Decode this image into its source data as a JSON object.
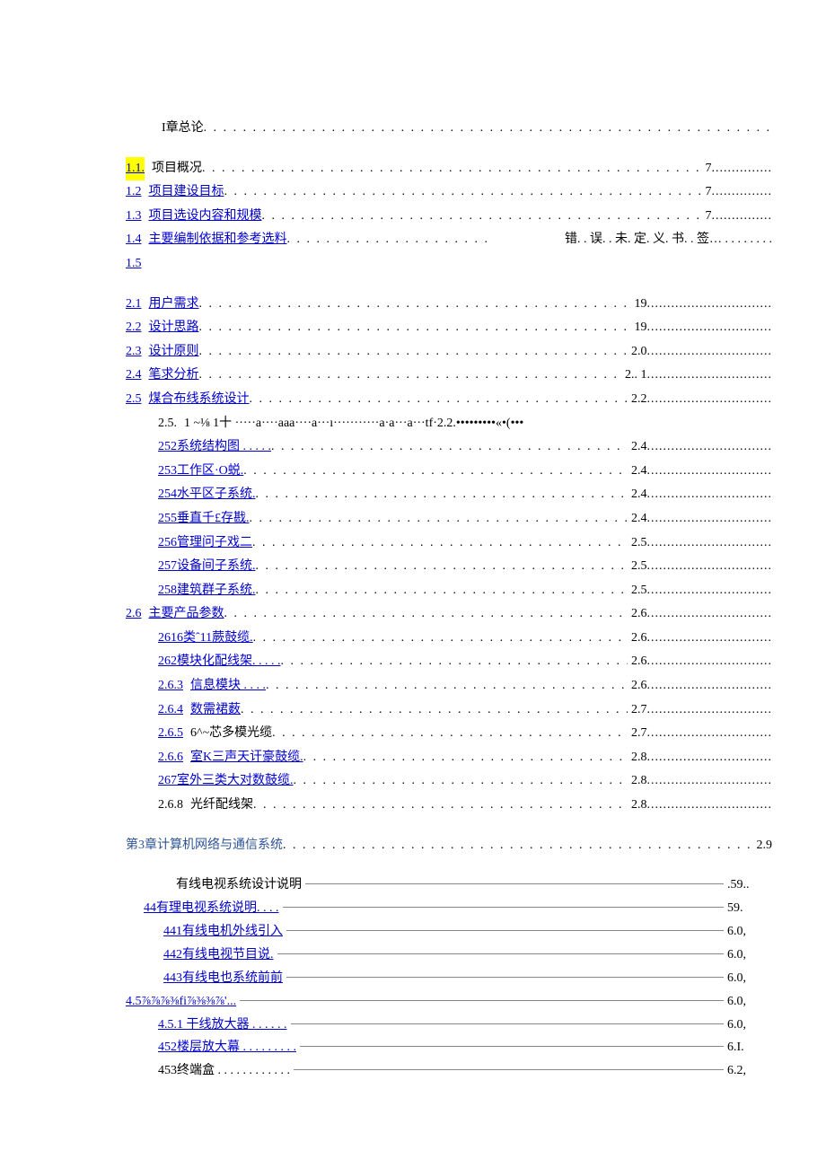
{
  "toc": [
    {
      "indent": 40,
      "num": "",
      "numLink": false,
      "label": "I章总论",
      "labelLink": false,
      "labelHl": false,
      "leader": ". . . . . . . . . . . . . . . . . . . . . . . . . . . . . . . . . . . . . . . . . . . . . . . . . . . . . . . . . . . . . . . .",
      "page": "",
      "trail": ""
    },
    {
      "gap": true
    },
    {
      "indent": 0,
      "num": "1.1.",
      "numLink": true,
      "numHl": true,
      "label": "项目概况",
      "labelLink": false,
      "labelHl": false,
      "leader": ". . . . . . . . . . . . . . . . . . . . . . . . . . . . . . . . . . . . . . . . . . . . . . . . . . . . . . . . . . . . . . . . . . . . . . .",
      "page": "7",
      "trail": " ..............."
    },
    {
      "indent": 0,
      "num": "1.2",
      "numLink": true,
      "label": "项目建设目标",
      "labelLink": true,
      "leader": ". . . . . . . . . . . . . . . . . . . . . . . . . . . . . . . . . . . . . . . . . . . . . . . . . . . . . . . . . . . .",
      "page": "7",
      "trail": " ..............."
    },
    {
      "indent": 0,
      "num": "1.3",
      "numLink": true,
      "label": "项目选设内容和规模",
      "labelLink": true,
      "leader": ". . . . . . . . . . . . . . . . . . . . . . . . . . . . . . . . . . . . . . . . . . . . . . . . . . . .",
      "page": "7",
      "trail": " ..............."
    },
    {
      "indent": 0,
      "num": "1.4",
      "numLink": true,
      "label": "主要编制依据和参考选料",
      "labelLink": true,
      "leader": " . . . . . . . . . . . . . . . . . . . . .",
      "page": "错. . 误. . 未. 定. 义. 书. . 签… . . . . . . . .",
      "trail": ""
    },
    {
      "indent": 0,
      "num": "1.5",
      "numLink": true,
      "label": "",
      "labelLink": false,
      "leader": "",
      "page": "",
      "trail": ""
    },
    {
      "gap": true
    },
    {
      "indent": 0,
      "num": "2.1",
      "numLink": true,
      "label": "用户需求",
      "labelLink": true,
      "leader": ". . . . . . . . . . . . . . . . . . . . . . . . . . . . . . . . . . . . . . . . . . . . . . . . . . . . . . . . . . . . . . . . . . . . .",
      "page": "19",
      "trail": " ..............................."
    },
    {
      "indent": 0,
      "num": "2.2",
      "numLink": true,
      "label": "设计思路",
      "labelLink": true,
      "leader": " . . . . . . . . . . . . . . . . . . . . . . . . . . . . . . . . . . . . . . . . . . . . . . . . . . . . . . . . . . . . . . . . . . . .",
      "page": "19",
      "trail": " ..............................."
    },
    {
      "indent": 0,
      "num": "2.3",
      "numLink": true,
      "label": "设计原则",
      "labelLink": true,
      "leader": ". . . . . . . . . . . . . . . . . . . . . . . . . . . . . . . . . . . . . . . . . . . . . . . . . . . . . . . . . . . . . . . . . .",
      "page": "2.0",
      "trail": " ..............................."
    },
    {
      "indent": 0,
      "num": "2.4",
      "numLink": true,
      "label": "笔求分析",
      "labelLink": true,
      "leader": " . . . . . . . . . . . . . . . . . . . . . . . . . . . . . . . . . . . . . . . . . . . . . . . . . . . . . . . . . . . . . . .",
      "page": "2..  1",
      "trail": " ..............................."
    },
    {
      "indent": 0,
      "num": "2.5",
      "numLink": true,
      "label": "煤合布线系统设计",
      "labelLink": true,
      "leader": ". . . . . . . . . . . . . . . . . . . . . . . . . . . . . . . . . . . . . . . . . . . . . . . . . . . . . . .",
      "page": "2.2",
      "trail": " ..............................."
    },
    {
      "indent": 36,
      "num": "2.5.",
      "numLink": false,
      "label": "1     ~⅛     1十 ·····a····aaa····a···ı···········a·a···a···tf·2.2.•••••••••«•(•••",
      "labelLink": false,
      "leader": "",
      "page": "",
      "trail": ""
    },
    {
      "indent": 36,
      "num": "",
      "numLink": false,
      "label": "252系统结构图 . . . . .",
      "labelLink": true,
      "leader": "  . . . . . . . . . . . . . . . . . . . . . . . . . . . . . . . . . . . . . . . . . . . . . . . . . . . . . . . .",
      "page": "2.4",
      "trail": " ..............................."
    },
    {
      "indent": 36,
      "num": "",
      "numLink": false,
      "label": "253工作区·O蜕.",
      "labelLink": true,
      "leader": " . . . . . . . . . . . . . . . . . . . . . . . . . . . . . . . . . . . . . . . . . . . . . . . . . . . . . . . . . . . . .",
      "page": "2.4",
      "trail": " ..............................."
    },
    {
      "indent": 36,
      "num": "",
      "numLink": false,
      "label": "254水平区子系统.",
      "labelLink": true,
      "leader": " . . . . . . . . . . . . . . . . . . . . . . . . . . . . . . . . . . . . . . . . . . . . . . . . . . . . . . . . . .",
      "page": "2.4",
      "trail": " ..............................."
    },
    {
      "indent": 36,
      "num": "",
      "numLink": false,
      "label": "255垂直千£存戡.",
      "labelLink": true,
      "leader": " . . . . . . . . . . . . . . . . . . . . . . . . . . . . . . . . . . . . . . . . . . . . . . . . . . . . . . . . .",
      "page": "2.4",
      "trail": " ..............................."
    },
    {
      "indent": 36,
      "num": "",
      "numLink": false,
      "label": "256管理问子戏二",
      "labelLink": true,
      "leader": ". . . . . . . . . . . . . . . . . . . . . . . . . . . . . . . . . . . . . . . . . . . . . . . . . . . . . . . . . . .",
      "page": "2.5",
      "trail": " ..............................."
    },
    {
      "indent": 36,
      "num": "",
      "numLink": false,
      "label": "257设备间子系统.",
      "labelLink": true,
      "leader": " . . . . . . . . . . . . . . . . . . . . . . . . . . . . . . . . . . . . . . . . . . . . . . . . . . . . . . . . . .",
      "page": "2.5",
      "trail": " ..............................."
    },
    {
      "indent": 36,
      "num": "",
      "numLink": false,
      "label": "258建筑群子系统.",
      "labelLink": true,
      "leader": " . . . . . . . . . . . . . . . . . . . . . . . . . . . . . . . . . . . . . . . . . . . . . . . . . . . . . . . . . .",
      "page": "2.5",
      "trail": " ..............................."
    },
    {
      "indent": 0,
      "num": "2.6",
      "numLink": true,
      "label": "主要产品参数",
      "labelLink": true,
      "leader": ". . . . . . . . . . . . . . . . . . . . . . . . . . . . . . . . . . . . . . . . . . . . . . . . . . . . . . . . . . . .",
      "page": "2.6",
      "trail": " ..............................."
    },
    {
      "indent": 36,
      "num": "",
      "numLink": false,
      "label": "2616类ˆ11蕨鼓缆.",
      "labelLink": true,
      "leader": " . . . . . . . . . . . . . . . . . . . . . . . . . . . . . . . . . . . . . . . . . . . . . . . . . . . . . . . . .",
      "page": "2.6",
      "trail": " ..............................."
    },
    {
      "indent": 36,
      "num": "",
      "numLink": false,
      "label": "262模块化配线架. . . . .",
      "labelLink": true,
      "leader": ". . . . . . . . . . . . . . . . . . . . . . . . . . . . . . . . . . . . . . . . . . . . . . . . . . . . .",
      "page": "2.6",
      "trail": " ..............................."
    },
    {
      "indent": 36,
      "num": "2.6.3",
      "numLink": true,
      "label": "信息模块 . . . .",
      "labelLink": true,
      "leader": " . . . . . . . . . . . . . . . . . . . . . . . . . . . . . . . . . . . . . . . . . . . . . . . . . . . . . . .",
      "page": "2.6",
      "trail": " ..............................."
    },
    {
      "indent": 36,
      "num": "2.6.4",
      "numLink": true,
      "label": "数需裙薮",
      "labelLink": true,
      "leader": " . . . . . . . . . . . . . . . . . . . . . . . . . . . . . . . . . . . . . . . . . . . . . . . . . . . . . . . . . . .",
      "page": "2.7",
      "trail": " ..............................."
    },
    {
      "indent": 36,
      "num": "2.6.5",
      "numLink": true,
      "label": "6^~芯多模光缆",
      "labelLink": false,
      "leader": " . . . . . . . . . . . . . . . . . . . . . . . . . . . . . . . . . . . . . . . . . . . . . . . . . . . . .",
      "page": "2.7",
      "trail": " ..............................."
    },
    {
      "indent": 36,
      "num": "2.6.6",
      "numLink": true,
      "label": "室K三声天讦豪鼓缆.",
      "labelLink": true,
      "leader": " . . . . . . . . . . . . . . . . . . . . . . . . . . . . . . . . . . . . . . . . . . . . . . . .",
      "page": "2.8",
      "trail": " ..............................."
    },
    {
      "indent": 36,
      "num": "",
      "numLink": false,
      "label": "267室外三类大对数鼓缆.",
      "labelLink": true,
      "leader": " . . . . . . . . . . . . . . . . . . . . . . . . . . . . . . . . . . . . . . . . . . . . . . . . . .",
      "page": "2.8",
      "trail": " ..............................."
    },
    {
      "indent": 36,
      "num": "2.6.8",
      "numLink": false,
      "label": "光纤配线架",
      "labelLink": false,
      "leader": " . . . . . . . . . . . . . . . . . . . . . . . . . . . . . . . . . . . . . . . . . . . . . . . . . . . . . . . .",
      "page": "2.8",
      "trail": " ..............................."
    },
    {
      "gap": true
    },
    {
      "indent": 0,
      "num": "",
      "numLink": false,
      "label": "第3章计算机网络与通信系统",
      "labelLink": false,
      "labelClass": "sec3",
      "leader": " . . . . . . . . . . . . . . . . . . . . . . . . . . . . . . . . . . . . . . . . . . . . . . . .",
      "page": "2.9",
      "trail": ""
    },
    {
      "gap": true
    }
  ],
  "table": [
    {
      "indent": 56,
      "label": "有线电视系统设计说明",
      "labelLink": false,
      "page": ".59.."
    },
    {
      "indent": 20,
      "label": "44有理电视系统说明. . . .",
      "labelLink": true,
      "page": "59."
    },
    {
      "indent": 42,
      "label": "441有线电机外线引入",
      "labelLink": true,
      "page": "6.0,"
    },
    {
      "indent": 42,
      "label": "442有线电视节目说.",
      "labelLink": true,
      "page": "6.0,"
    },
    {
      "indent": 42,
      "label": "443有线电也系统前前",
      "labelLink": true,
      "page": "6.0,"
    },
    {
      "indent": 0,
      "label": "4.5⅞⅞⅞⅜fi⅞⅜⅜⅞'...",
      "labelLink": true,
      "page": "6.0,"
    },
    {
      "indent": 36,
      "label": "4.5.1   干线放大器 . . . . . .",
      "labelLink": true,
      "page": "6.0,"
    },
    {
      "indent": 36,
      "label": "452楼层放大幕 . . . . . . . . .",
      "labelLink": true,
      "page": "6.I."
    },
    {
      "indent": 36,
      "label": "453终端盒 . . . . . . . .   . . . .",
      "labelLink": false,
      "page": "6.2,"
    }
  ]
}
